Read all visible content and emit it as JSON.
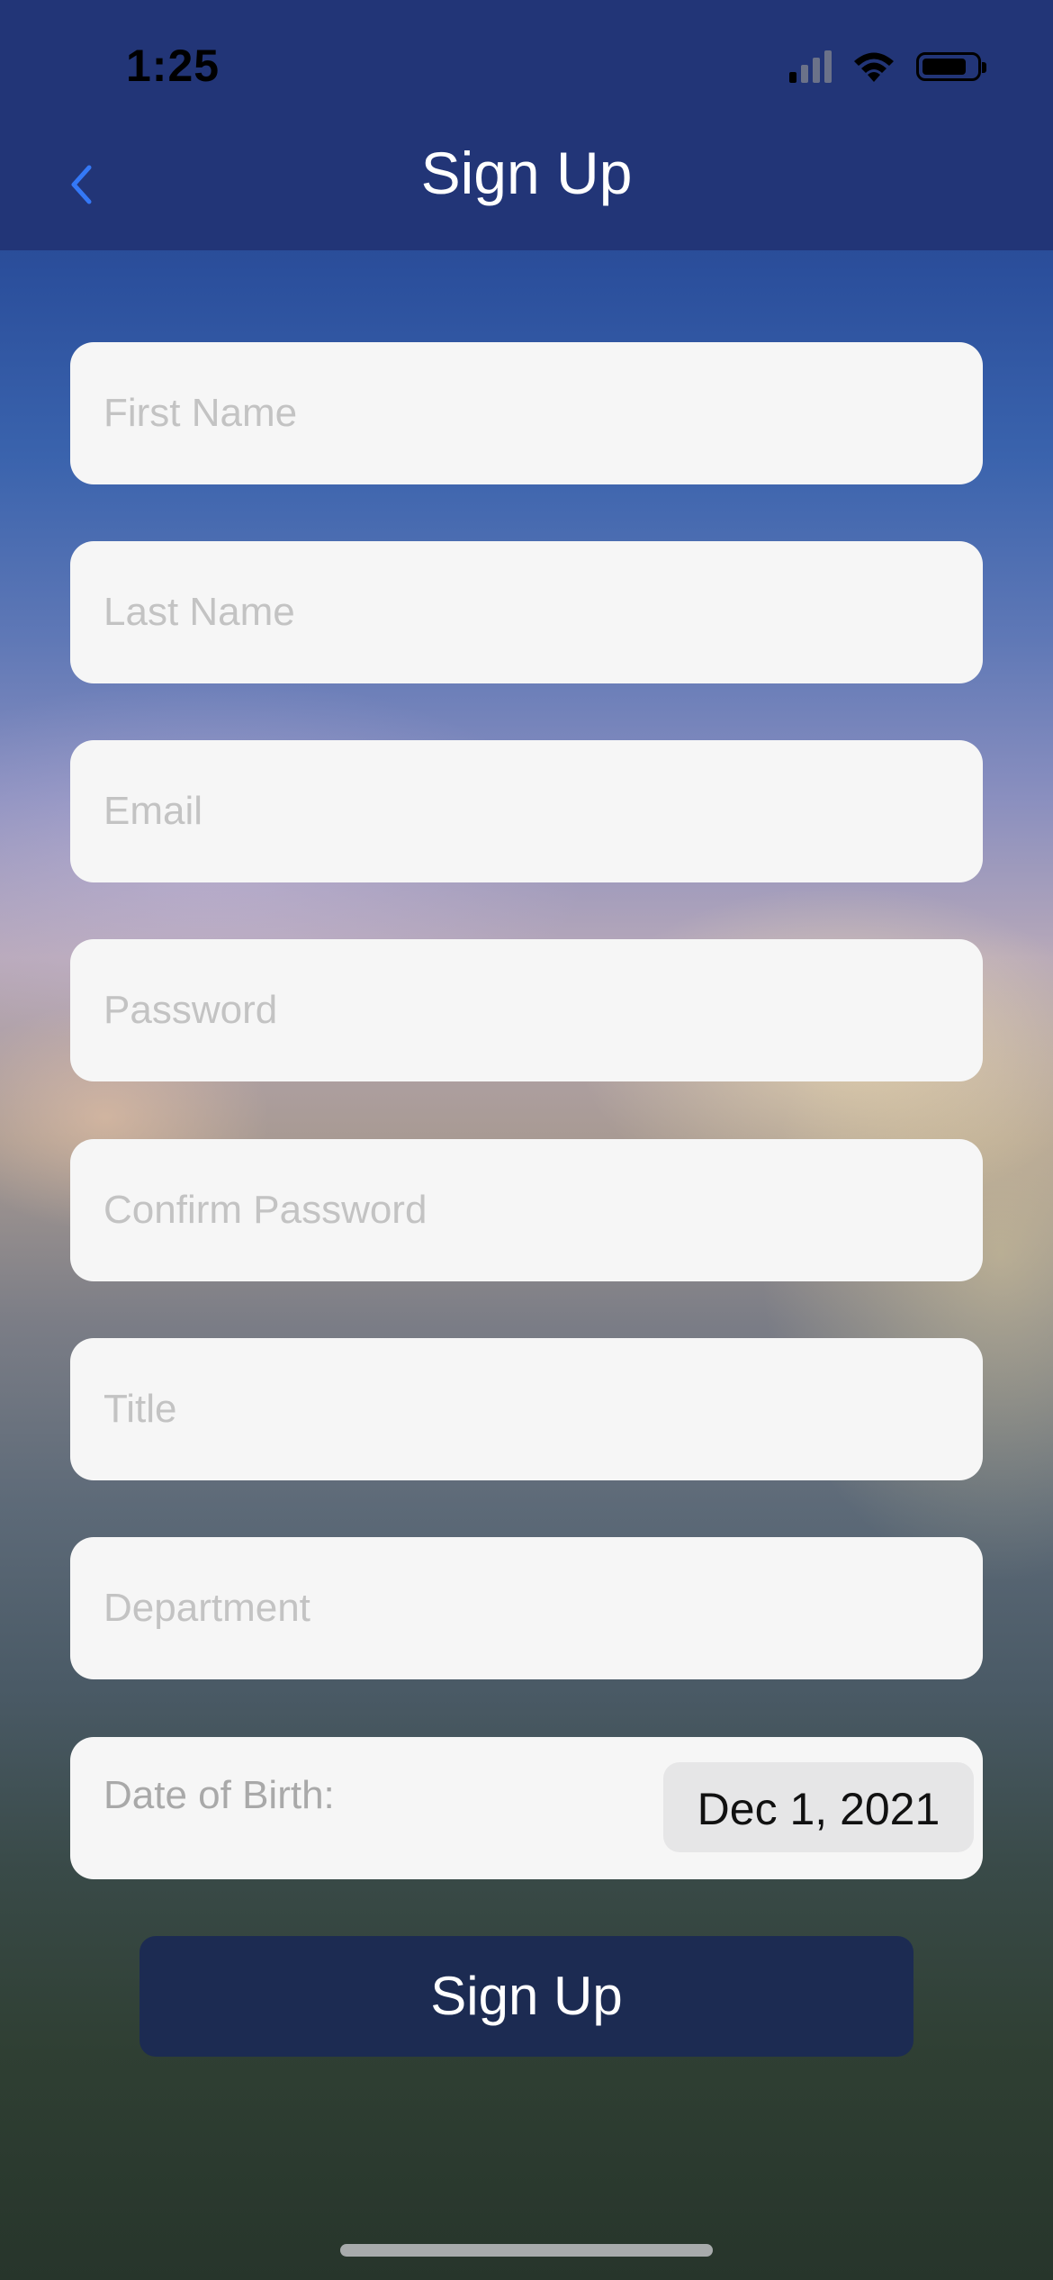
{
  "status_bar": {
    "time": "1:25"
  },
  "nav": {
    "title": "Sign Up",
    "back_icon": "chevron-left-icon",
    "accent_color": "#3478f6"
  },
  "form": {
    "fields": [
      {
        "placeholder": "First Name"
      },
      {
        "placeholder": "Last Name"
      },
      {
        "placeholder": "Email"
      },
      {
        "placeholder": "Password"
      },
      {
        "placeholder": "Confirm Password"
      },
      {
        "placeholder": "Title"
      },
      {
        "placeholder": "Department"
      }
    ],
    "dob_label": "Date of Birth:",
    "dob_value": "Dec 1, 2021",
    "submit_label": "Sign Up"
  },
  "colors": {
    "header_bg": "#223577",
    "button_bg": "#1c2b52",
    "field_bg": "#f6f6f6"
  }
}
